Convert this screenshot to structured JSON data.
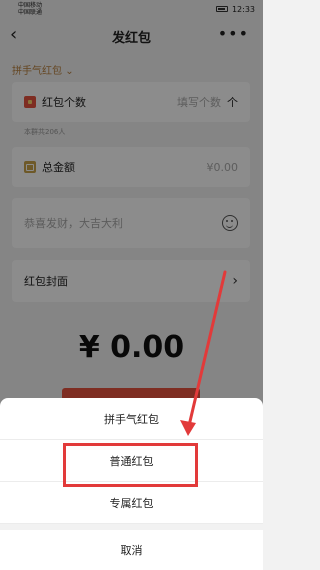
{
  "status_bar": {
    "carrier_1": "中国移动",
    "carrier_2": "中国联通",
    "time": "12:33"
  },
  "nav": {
    "title": "发红包",
    "back_icon": "chevron-left-icon",
    "more_icon": "more-dots-icon"
  },
  "packet_type_selector": "拼手气红包",
  "count_field": {
    "label": "红包个数",
    "placeholder": "填写个数",
    "suffix": "个"
  },
  "group_note": "本群共206人",
  "total_field": {
    "label": "总金额",
    "value": "¥0.00"
  },
  "message_field": {
    "placeholder": "恭喜发财，大吉大利"
  },
  "cover_row": {
    "label": "红包封面"
  },
  "amount_display": "¥ 0.00",
  "action_sheet": {
    "items": [
      "拼手气红包",
      "普通红包",
      "专属红包"
    ],
    "cancel": "取消",
    "highlighted_item": "普通红包"
  },
  "colors": {
    "accent_red": "#e5533e",
    "highlight_red": "#e23a3a",
    "type_selector_gold": "#b8803e"
  }
}
